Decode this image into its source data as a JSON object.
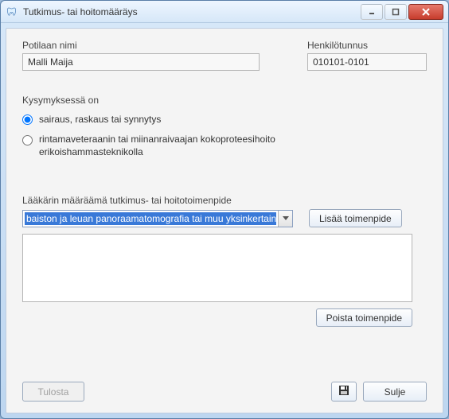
{
  "window": {
    "title": "Tutkimus- tai hoitomääräys"
  },
  "patient": {
    "name_label": "Potilaan nimi",
    "name_value": "Malli Maija",
    "id_label": "Henkilötunnus",
    "id_value": "010101-0101"
  },
  "question": {
    "group_label": "Kysymyksessä on",
    "options": {
      "opt1": "sairaus, raskaus tai synnytys",
      "opt2": "rintamaveteraanin tai miinanraivaajan kokoproteesihoito erikoishammasteknikolla"
    },
    "selected": "opt1"
  },
  "procedure": {
    "label": "Lääkärin määräämä tutkimus- tai hoitotoimenpide",
    "selected_text": "baiston ja leuan panoraamatomografia tai muu yksinkertainen rakokuvaus",
    "add_button": "Lisää toimenpide",
    "remove_button": "Poista toimenpide"
  },
  "footer": {
    "print": "Tulosta",
    "close": "Sulje"
  },
  "icons": {
    "app": "tooth-icon",
    "save": "floppy-icon"
  },
  "colors": {
    "selection_bg": "#3979d8",
    "window_frame": "#bdd6f0"
  }
}
